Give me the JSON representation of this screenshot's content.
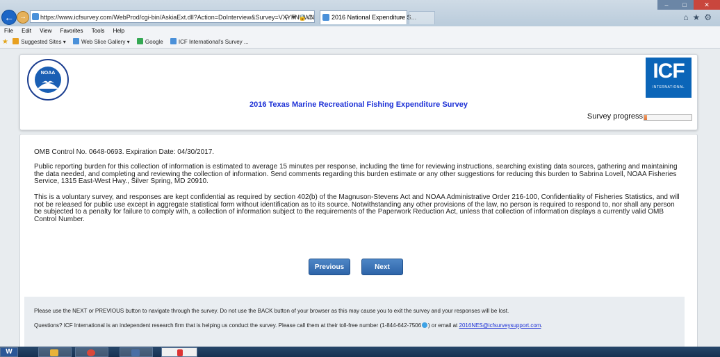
{
  "browser": {
    "address_url": "https://www.icfsurvey.com/WebProd/cgi-bin/AskiaExt.dll?Action=DoInterview&Survey=VXYFNUWNDI",
    "tab_title": "2016 National Expenditure S...",
    "tab_close": "×",
    "menu": [
      "File",
      "Edit",
      "View",
      "Favorites",
      "Tools",
      "Help"
    ],
    "favorites": [
      "Suggested Sites ▾",
      "Web Slice Gallery ▾",
      "Google",
      "ICF International's Survey ..."
    ]
  },
  "header": {
    "noaa_logo_text": "NOAA",
    "survey_title": "2016 Texas Marine Recreational Fishing Expenditure Survey",
    "icf_logo": "ICF",
    "icf_sub": "INTERNATIONAL",
    "progress_label": "Survey progress",
    "progress_percent": 6
  },
  "content": {
    "omb_line": "OMB Control No. 0648-0693. Expiration Date: 04/30/2017.",
    "paragraph1": "Public reporting burden for this collection of information is estimated to average 15 minutes per response, including the time for reviewing instructions, searching existing data sources, gathering and maintaining the data needed, and completing and reviewing the collection of information. Send comments regarding this burden estimate or any other suggestions for reducing this burden to Sabrina Lovell, NOAA Fisheries Service, 1315 East-West Hwy., Silver Spring, MD 20910.",
    "paragraph2": "This is a voluntary survey, and responses are kept confidential as required by section 402(b) of the Magnuson-Stevens Act and NOAA Administrative Order 216-100, Confidentiality of Fisheries Statistics, and will not be released for public use except in aggregate statistical form without identification as to its source. Notwithstanding any other provisions of the law, no person is required to respond to, nor shall any person be subjected to a penalty for failure to comply with, a collection of information subject to the requirements of the Paperwork Reduction Act, unless that collection of information displays a currently valid OMB Control Number.",
    "previous_label": "Previous",
    "next_label": "Next"
  },
  "footer": {
    "nav_note": "Please use the NEXT or PREVIOUS button to navigate through the survey. Do not use the BACK button of your browser as this may cause you to exit the survey and your responses will be lost.",
    "questions_prefix": "Questions? ICF International is an independent research firm that is helping us conduct the survey. Please call them at their toll-free number (1-844-642-7506",
    "questions_mid": ") or email at ",
    "email": "2016NES@icfsurveysupport.com",
    "questions_suffix": "."
  },
  "taskbar": {
    "word_label": "W"
  }
}
